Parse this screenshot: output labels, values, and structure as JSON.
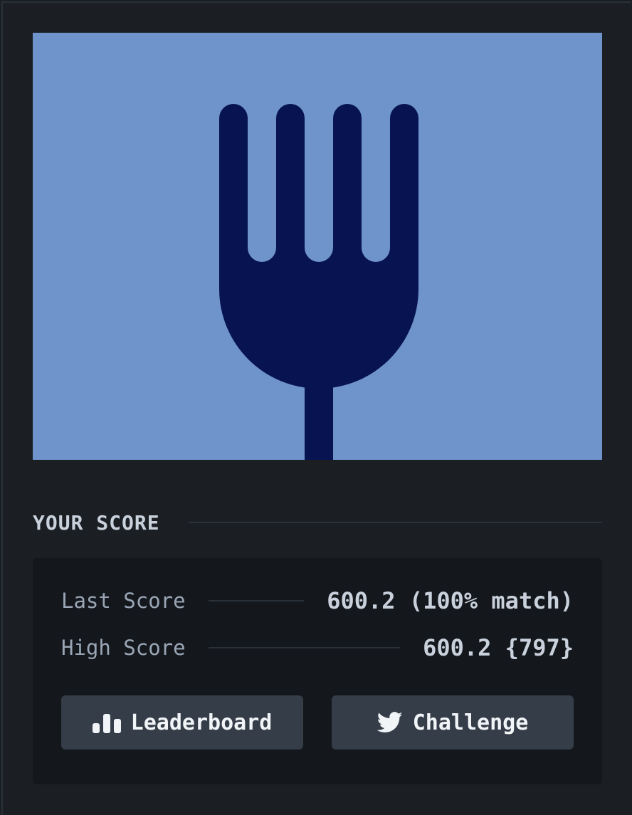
{
  "artwork": {
    "icon": "fork-icon",
    "background_color": "#6f94cc",
    "icon_color": "#081352"
  },
  "score_section": {
    "title": "YOUR SCORE",
    "last_score_label": "Last Score",
    "last_score_value": "600.2 (100% match)",
    "high_score_label": "High Score",
    "high_score_value": "600.2 {797}"
  },
  "actions": {
    "leaderboard_label": "Leaderboard",
    "leaderboard_icon": "bar-chart-icon",
    "challenge_label": "Challenge",
    "challenge_icon": "twitter-icon"
  }
}
